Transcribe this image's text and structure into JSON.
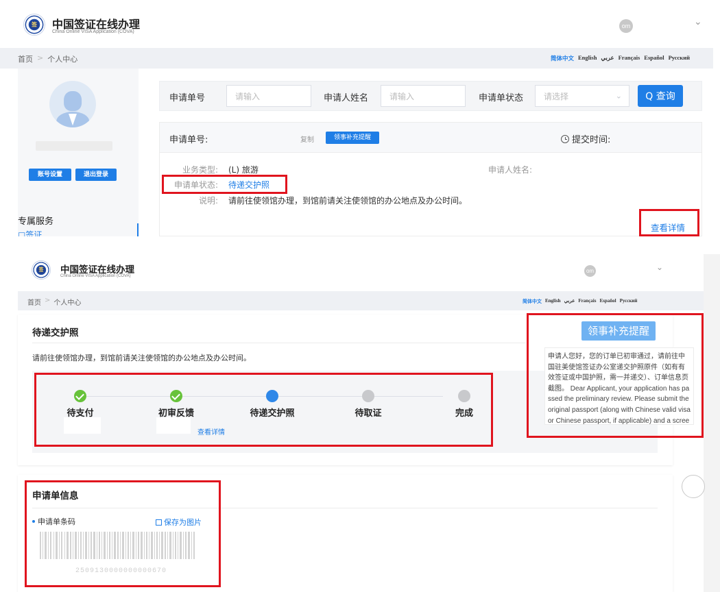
{
  "top": {
    "brand_title": "中国签证在线办理",
    "brand_sub": "China Online VISA Application (COVA)",
    "avatar": "om",
    "chevron": "⌄",
    "breadcrumb": [
      "首页",
      ">",
      "个人中心"
    ],
    "languages": [
      "简体中文",
      "English",
      "عربي",
      "Français",
      "Español",
      "Русский"
    ],
    "account_settings": "账号设置",
    "logout": "退出登录",
    "exclusive_services": "专属服务",
    "visa_item": "签证",
    "search": {
      "order_no_label": "申请单号",
      "order_no_placeholder": "请输入",
      "name_label": "申请人姓名",
      "name_placeholder": "请输入",
      "status_label": "申请单状态",
      "status_placeholder": "请选择",
      "query_button": "Q 查询"
    },
    "order": {
      "order_no_label": "申请单号:",
      "copy": "复制",
      "consular_tag": "领事补充提醒",
      "submit_time": "提交时间:",
      "biz_type_label": "业务类型:",
      "biz_type_value": "(L) 旅游",
      "applicant_name_label": "申请人姓名:",
      "status_label": "申请单状态:",
      "status_value": "待递交护照",
      "note_label": "说明:",
      "note_value": "请前往使领馆办理，到馆前请关注使领馆的办公地点及办公时间。",
      "view_details": "查看详情"
    }
  },
  "bottom": {
    "brand_title": "中国签证在线办理",
    "brand_sub": "China Online VISA Application (COVA)",
    "avatar": "om",
    "chevron": "⌄",
    "breadcrumb": [
      "首页",
      ">",
      "个人中心"
    ],
    "languages": [
      "简体中文",
      "English",
      "عربي",
      "Français",
      "Español",
      "Русский"
    ],
    "status_title": "待递交护照",
    "status_desc": "请前往使领馆办理，到馆前请关注使领馆的办公地点及办公时间。",
    "steps": [
      {
        "label": "待支付",
        "state": "done"
      },
      {
        "label": "初审反馈",
        "state": "done"
      },
      {
        "label": "待递交护照",
        "state": "current"
      },
      {
        "label": "待取证",
        "state": "wait"
      },
      {
        "label": "完成",
        "state": "wait"
      }
    ],
    "step_view_details": "查看详情",
    "consular_button": "领事补充提醒",
    "consular_notice": "申请人您好，您的订单已初审通过，请前往中国驻美使馆签证办公室递交护照原件（如有有效签证或中国护照，需一并递交）、订单信息页截图。 Dear Applicant, your application has passed the preliminary review. Please submit the original passport (along with Chinese valid visa or Chinese passport, if applicable) and a screenshot of the order information page to the Chinese Em",
    "info_title": "申请单信息",
    "barcode_label": "申请单条码",
    "save_image": "保存为图片",
    "barcode_number": "2509130000000000670"
  }
}
